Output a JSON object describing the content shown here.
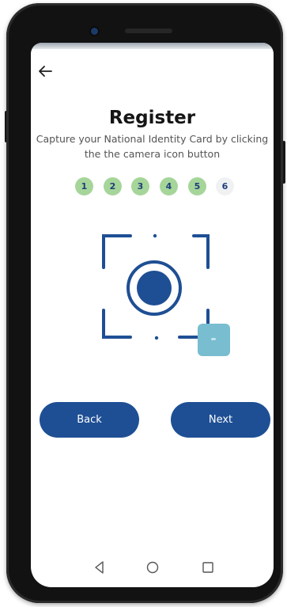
{
  "header": {
    "back_icon": "arrow-left-icon"
  },
  "main": {
    "title": "Register",
    "subtitle": "Capture your National Identity Card by clicking the the camera icon button"
  },
  "steps": [
    {
      "label": "1",
      "status": "done"
    },
    {
      "label": "2",
      "status": "done"
    },
    {
      "label": "3",
      "status": "done"
    },
    {
      "label": "4",
      "status": "done"
    },
    {
      "label": "5",
      "status": "done"
    },
    {
      "label": "6",
      "status": "current"
    }
  ],
  "camera": {
    "icon": "camera-frame-icon",
    "fab_icon": "capture-icon"
  },
  "buttons": {
    "back_label": "Back",
    "next_label": "Next"
  },
  "system_nav": {
    "back_icon": "triangle-back-icon",
    "home_icon": "circle-home-icon",
    "recents_icon": "square-recents-icon"
  },
  "colors": {
    "primary": "#1e4f94",
    "step_done": "#a6d59a",
    "step_pending": "#f0f1f3",
    "fab": "#78bdd0",
    "title": "#151515"
  }
}
